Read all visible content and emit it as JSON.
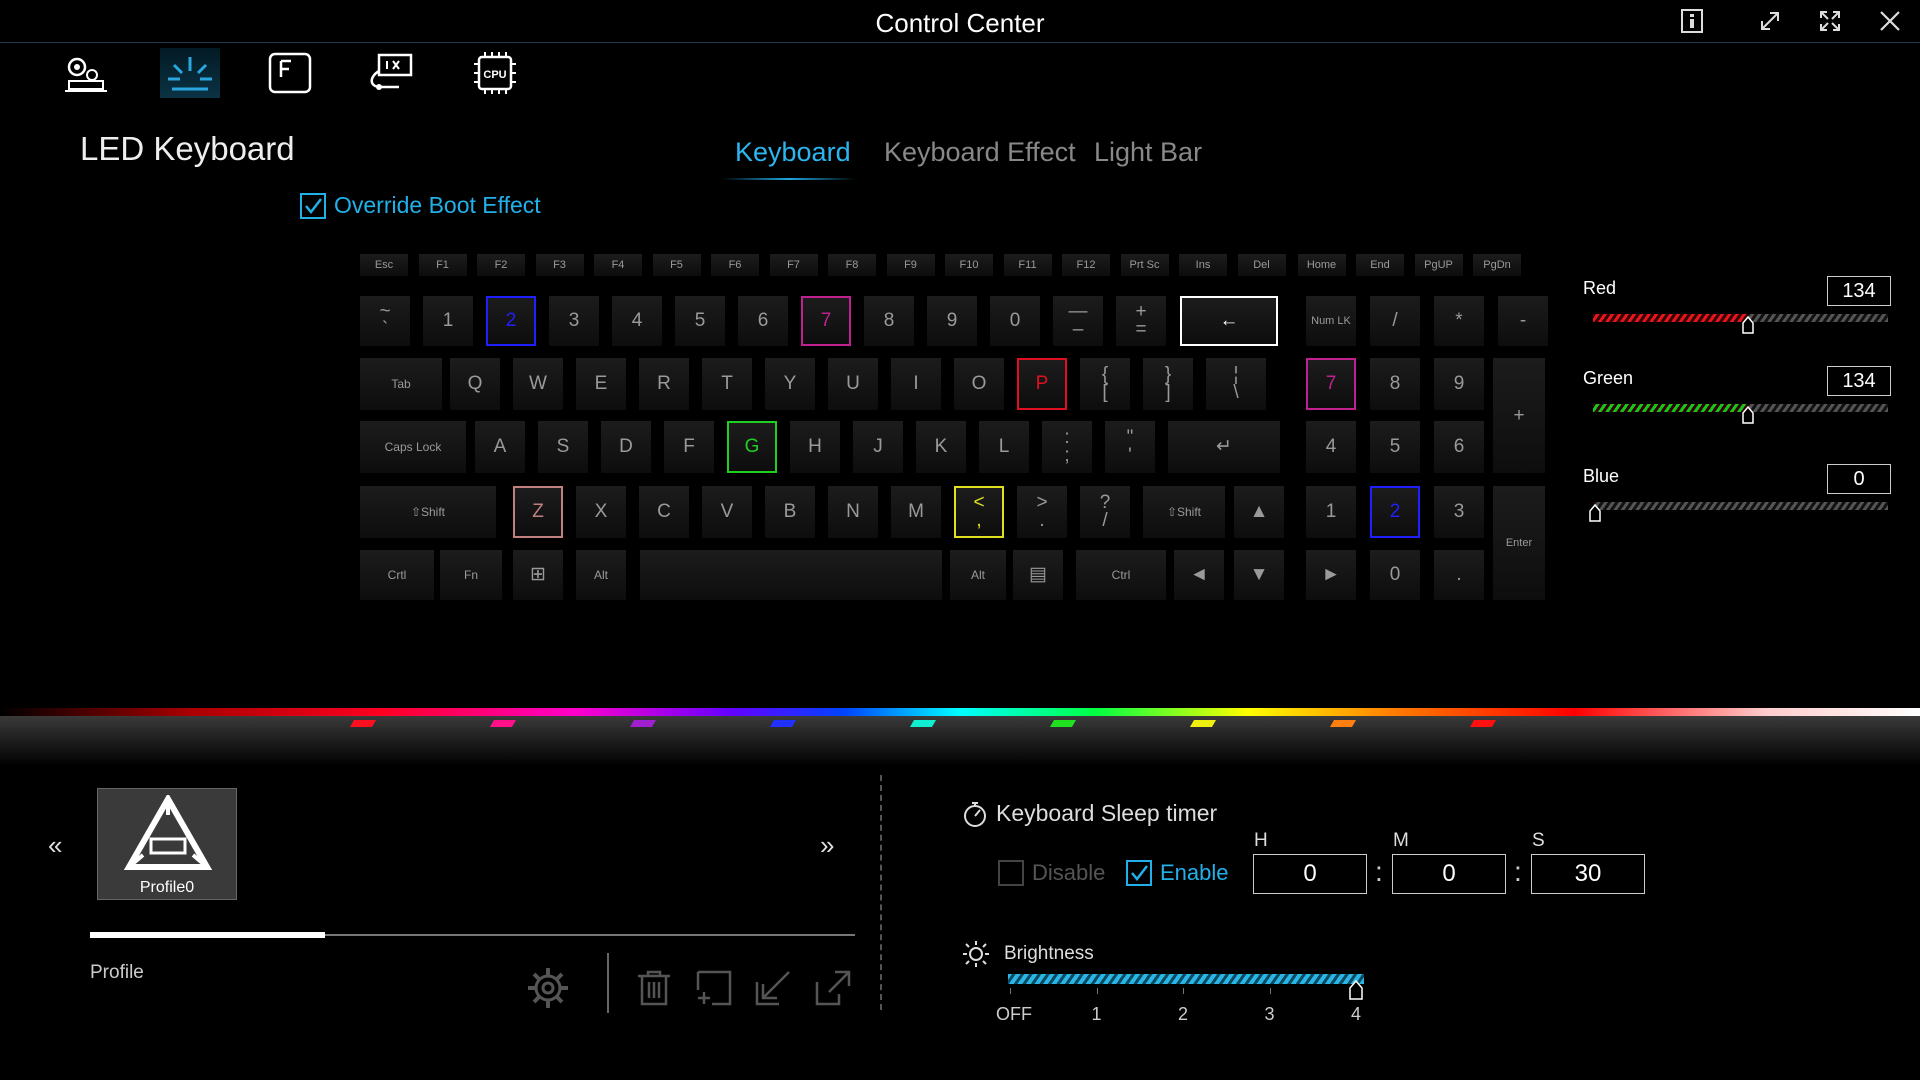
{
  "window": {
    "title": "Control Center"
  },
  "header": {
    "page_title": "LED Keyboard",
    "tabs": [
      {
        "label": "Keyboard"
      },
      {
        "label": "Keyboard Effect"
      },
      {
        "label": "Light Bar"
      }
    ],
    "override_label": "Override Boot Effect"
  },
  "keyboard": {
    "fn_row": [
      "Esc",
      "F1",
      "F2",
      "F3",
      "F4",
      "F5",
      "F6",
      "F7",
      "F8",
      "F9",
      "F10",
      "F11",
      "F12",
      "Prt Sc",
      "Ins",
      "Del",
      "Home",
      "End",
      "PgUP",
      "PgDn"
    ],
    "num_row": [
      "~\n`",
      "1",
      "2",
      "3",
      "4",
      "5",
      "6",
      "7",
      "8",
      "9",
      "0",
      "—\n–",
      "+\n=",
      "←",
      "Num LK",
      "/",
      "*",
      "-"
    ],
    "q_row": [
      "Tab",
      "Q",
      "W",
      "E",
      "R",
      "T",
      "Y",
      "U",
      "I",
      "O",
      "P",
      "{\n[",
      "}\n]",
      "¦\n\\",
      "7",
      "8",
      "9"
    ],
    "a_row": [
      "Caps Lock",
      "A",
      "S",
      "D",
      "F",
      "G",
      "H",
      "J",
      "K",
      "L",
      ":\n;",
      "\"\n'",
      "↵",
      "4",
      "5",
      "6"
    ],
    "z_row": [
      "⇧Shift",
      "Z",
      "X",
      "C",
      "V",
      "B",
      "N",
      "M",
      "<\n,",
      ">\n.",
      "?\n/",
      "⇧Shift",
      "▲",
      "1",
      "2",
      "3"
    ],
    "bottom_row": [
      "Crtl",
      "Fn",
      "⊞",
      "Alt",
      "",
      "Alt",
      "▤",
      "Ctrl",
      "◄",
      "▼",
      "►",
      "0",
      "."
    ],
    "numpad_plus": "+",
    "numpad_enter": "Enter",
    "highlight_colors": {
      "2": "#2020ff",
      "7": "#c02090",
      "P": "#e01020",
      "G": "#20d020",
      "Z": "#c08080",
      "<\n,": "#e0e020",
      "←": "#ffffff"
    }
  },
  "color_sliders": [
    {
      "label": "Red",
      "value": "134",
      "fraction": 0.525,
      "color": "#e8141e"
    },
    {
      "label": "Green",
      "value": "134",
      "fraction": 0.525,
      "color": "#16c81e"
    },
    {
      "label": "Blue",
      "value": "0",
      "fraction": 0.0,
      "color": "#1a4cf0"
    }
  ],
  "profile": {
    "prev_label": "«",
    "next_label": "»",
    "card_name": "Profile0",
    "section_label": "Profile",
    "actions": [
      "gear-icon",
      "trash-icon",
      "add-icon",
      "import-icon",
      "export-icon"
    ]
  },
  "sleep_timer": {
    "title": "Keyboard Sleep timer",
    "disable_label": "Disable",
    "enable_label": "Enable",
    "h_label": "H",
    "m_label": "M",
    "s_label": "S",
    "h_value": "0",
    "m_value": "0",
    "s_value": "30"
  },
  "brightness": {
    "title": "Brightness",
    "levels": [
      "OFF",
      "1",
      "2",
      "3",
      "4"
    ],
    "value": 4,
    "max": 4
  },
  "colors": {
    "accent": "#22b0e8",
    "background": "#000000"
  }
}
